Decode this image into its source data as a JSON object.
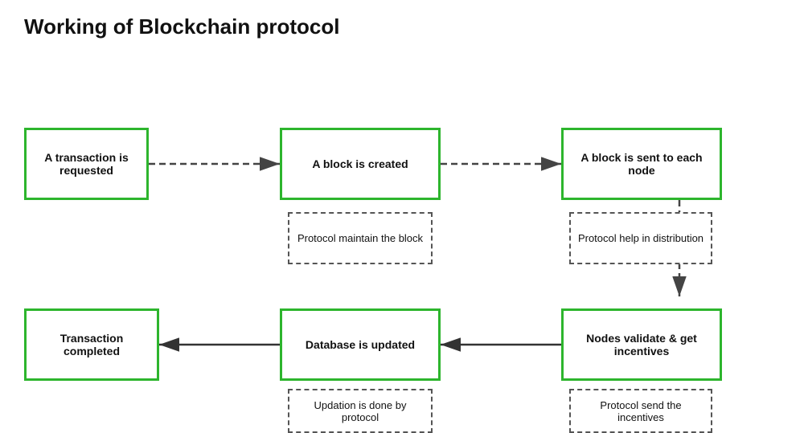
{
  "title": "Working of Blockchain protocol",
  "nodes": {
    "transaction_requested": "A transaction is requested",
    "block_created": "A block is created",
    "block_sent": "A block is sent to each node",
    "transaction_completed": "Transaction completed",
    "database_updated": "Database is updated",
    "nodes_validate": "Nodes validate & get incentives"
  },
  "sub_nodes": {
    "protocol_maintain": "Protocol maintain the block",
    "protocol_help": "Protocol help in distribution",
    "updation_done": "Updation is done by protocol",
    "protocol_send": "Protocol send the incentives"
  }
}
